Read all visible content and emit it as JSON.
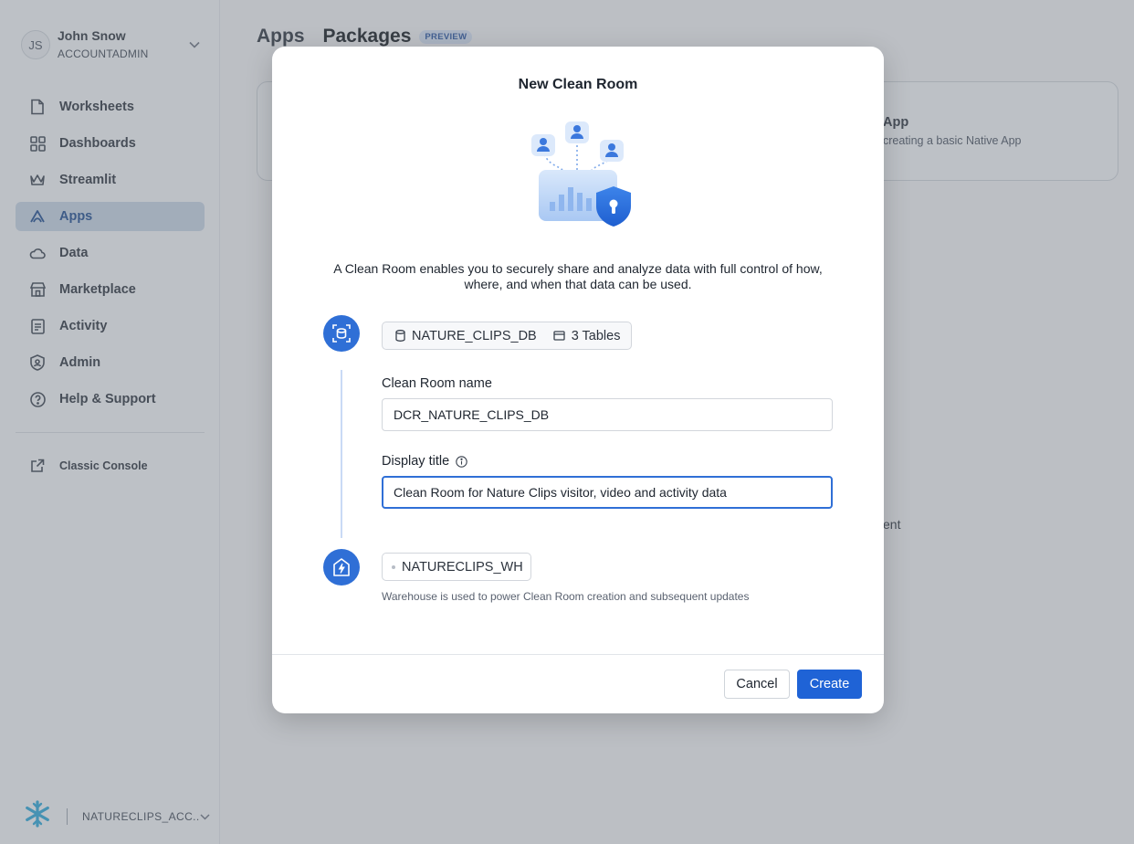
{
  "user": {
    "initials": "JS",
    "name": "John Snow",
    "role": "ACCOUNTADMIN"
  },
  "nav": {
    "items": [
      {
        "label": "Worksheets",
        "icon": "worksheet-icon"
      },
      {
        "label": "Dashboards",
        "icon": "dashboard-grid-icon"
      },
      {
        "label": "Streamlit",
        "icon": "streamlit-crown-icon"
      },
      {
        "label": "Apps",
        "icon": "apps-icon",
        "active": true
      },
      {
        "label": "Data",
        "icon": "cloud-icon"
      },
      {
        "label": "Marketplace",
        "icon": "store-icon"
      },
      {
        "label": "Activity",
        "icon": "activity-icon"
      },
      {
        "label": "Admin",
        "icon": "shield-icon"
      },
      {
        "label": "Help & Support",
        "icon": "help-circle-icon"
      }
    ],
    "classic_console": "Classic Console"
  },
  "account": {
    "name": "NATURECLIPS_ACCOUNT",
    "display": "NATURECLIPS_ACC..."
  },
  "main": {
    "tabs": [
      "Apps",
      "Packages"
    ],
    "badge": "PREVIEW",
    "card_title": "App",
    "card_desc": "creating a basic Native App",
    "bg_text": "ent"
  },
  "modal": {
    "title": "New Clean Room",
    "description": "A Clean Room enables you to securely share and analyze data with full control of how, where, and when that data can be used.",
    "database": "NATURE_CLIPS_DB",
    "tables": "3 Tables",
    "clean_room_name_label": "Clean Room name",
    "clean_room_name_value": "DCR_NATURE_CLIPS_DB",
    "display_title_label": "Display title",
    "display_title_value": "Clean Room for Nature Clips visitor, video and activity data",
    "warehouse": "NATURECLIPS_WH",
    "warehouse_help": "Warehouse is used to power Clean Room creation and subsequent updates",
    "cancel_label": "Cancel",
    "create_label": "Create"
  },
  "colors": {
    "accent": "#1f63d6",
    "active_nav": "#c9d6e6"
  }
}
